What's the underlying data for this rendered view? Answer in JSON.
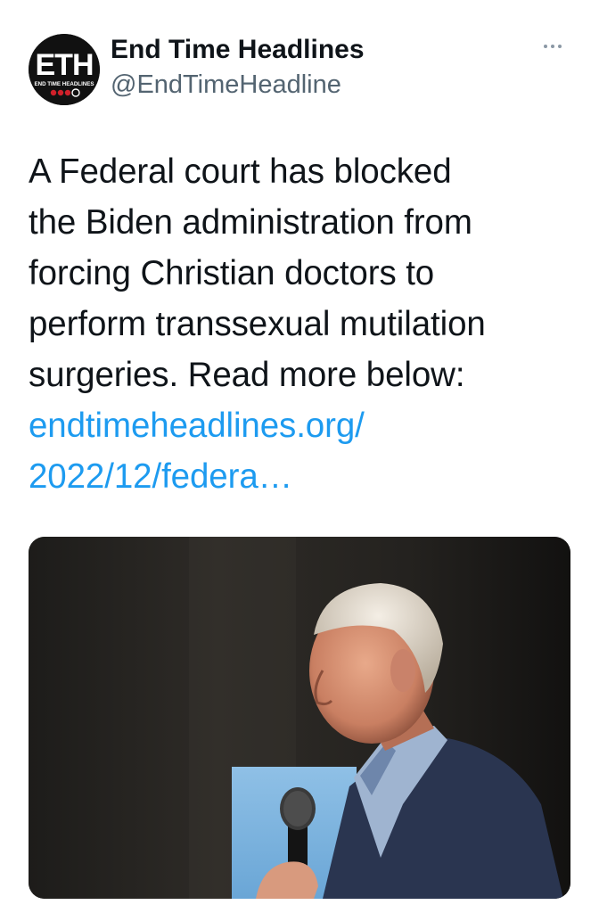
{
  "tweet": {
    "author": {
      "display_name": "End Time Headlines",
      "handle": "@EndTimeHeadline",
      "avatar": {
        "letters": "ETH",
        "subtitle": "END TIME HEADLINES"
      }
    },
    "more_icon": "ellipsis-icon",
    "text_lines": [
      "A Federal court has blocked",
      "the Biden administration from",
      "forcing Christian doctors to",
      "perform transsexual mutilation",
      "surgeries. Read more below:"
    ],
    "link_lines": [
      "endtimeheadlines.org/",
      "2022/12/federa…"
    ],
    "colors": {
      "text": "#0f1419",
      "secondary": "#536471",
      "link": "#1d9bf0",
      "accent_red": "#d0202a"
    }
  }
}
